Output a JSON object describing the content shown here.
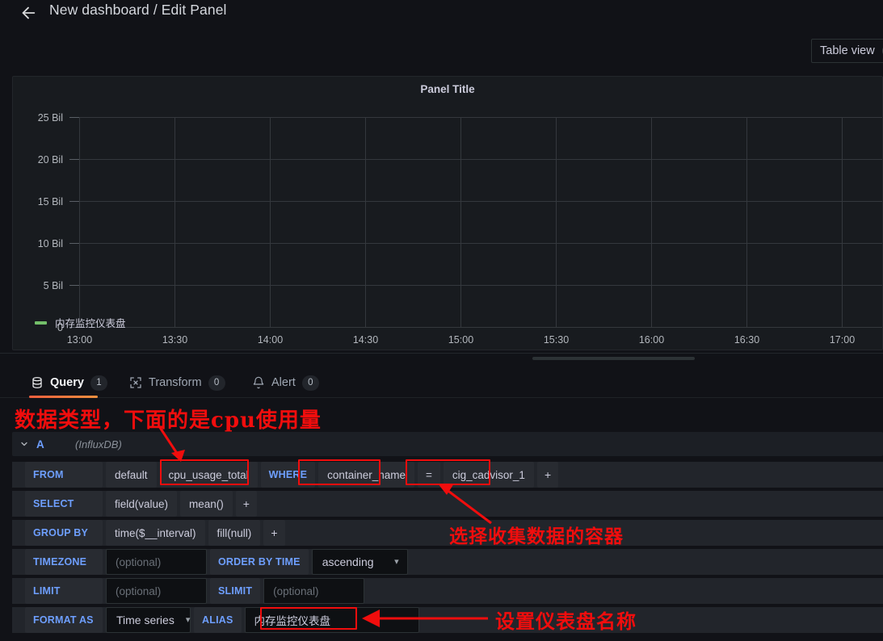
{
  "header": {
    "back_icon": "arrow-left-icon",
    "breadcrumb": "New dashboard / Edit Panel",
    "table_view_label": "Table view",
    "table_view_state": "off"
  },
  "panel": {
    "title": "Panel Title",
    "legend": [
      {
        "label": "内存监控仪表盘",
        "color": "#73bf69"
      }
    ]
  },
  "chart_data": {
    "type": "line",
    "title": "Panel Title",
    "xlabel": "",
    "ylabel": "",
    "grid": true,
    "legend_position": "bottom-left",
    "series": [
      {
        "name": "内存监控仪表盘",
        "color": "#73bf69",
        "values": []
      }
    ],
    "x_tick_labels": [
      "13:00",
      "13:30",
      "14:00",
      "14:30",
      "15:00",
      "15:30",
      "16:00",
      "16:30",
      "17:00"
    ],
    "y_tick_labels": [
      "0",
      "5 Bil",
      "10 Bil",
      "15 Bil",
      "20 Bil",
      "25 Bil"
    ],
    "y_tick_values": [
      0,
      5000000000,
      10000000000,
      15000000000,
      20000000000,
      25000000000
    ],
    "ylim": [
      0,
      25000000000
    ],
    "note": "no data plotted; empty time series panel"
  },
  "tabs": [
    {
      "id": "query",
      "label": "Query",
      "count": "1",
      "icon": "database-icon",
      "active": true
    },
    {
      "id": "transform",
      "label": "Transform",
      "count": "0",
      "icon": "transform-icon",
      "active": false
    },
    {
      "id": "alert",
      "label": "Alert",
      "count": "0",
      "icon": "bell-icon",
      "active": false
    }
  ],
  "query": {
    "collapse_icon": "chevron-down-icon",
    "ref_id": "A",
    "datasource": "(InfluxDB)",
    "rows": {
      "from": {
        "label": "FROM",
        "policy": "default",
        "measurement": "cpu_usage_total",
        "where_label": "WHERE",
        "tag_key": "container_name",
        "operator": "=",
        "tag_value": "cig_cadvisor_1",
        "add": "+"
      },
      "select": {
        "label": "SELECT",
        "field": "field(value)",
        "aggregate": "mean()",
        "add": "+"
      },
      "group_by": {
        "label": "GROUP BY",
        "time": "time($__interval)",
        "fill": "fill(null)",
        "add": "+"
      },
      "timezone": {
        "label": "TIMEZONE",
        "placeholder": "(optional)",
        "order_label": "ORDER BY TIME",
        "order_value": "ascending"
      },
      "limit": {
        "label": "LIMIT",
        "placeholder": "(optional)",
        "slimit_label": "SLIMIT",
        "slimit_placeholder": "(optional)"
      },
      "format": {
        "label": "FORMAT AS",
        "value": "Time series",
        "alias_label": "ALIAS",
        "alias_value": "内存监控仪表盘"
      }
    }
  },
  "annotations": {
    "color": "#f10d0d",
    "items": [
      {
        "id": "data-type-note",
        "text": "数据类型，下面的是cpu使用量"
      },
      {
        "id": "container-note",
        "text": "选择收集数据的容器"
      },
      {
        "id": "dashboard-name-note",
        "text": "设置仪表盘名称"
      }
    ]
  }
}
